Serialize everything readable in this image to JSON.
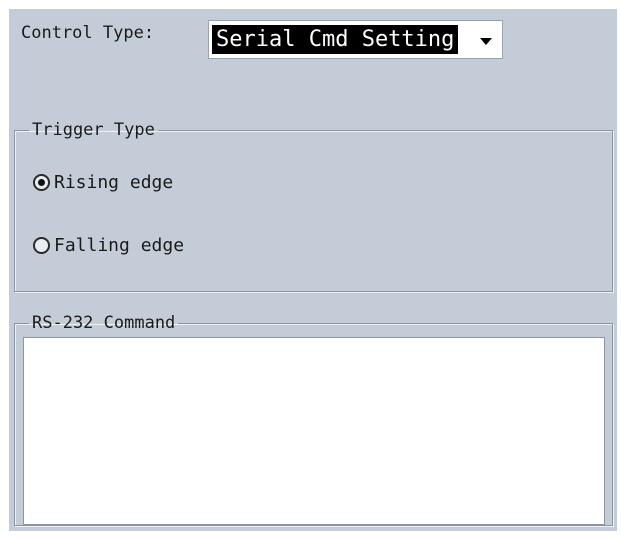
{
  "control_type": {
    "label": "Control Type:",
    "selected": "Serial Cmd Setting"
  },
  "trigger_type": {
    "legend": "Trigger Type",
    "options": [
      {
        "label": "Rising edge",
        "checked": true
      },
      {
        "label": "Falling edge",
        "checked": false
      }
    ]
  },
  "rs232": {
    "legend": "RS-232 Command",
    "value": ""
  },
  "colors": {
    "panel_bg": "#c4cdd7",
    "selection_bg": "#000000",
    "selection_text": "#ffffff"
  },
  "icons": {
    "dropdown": "chevron-down-icon",
    "radio_checked": "radio-checked-icon",
    "radio_unchecked": "radio-unchecked-icon"
  }
}
